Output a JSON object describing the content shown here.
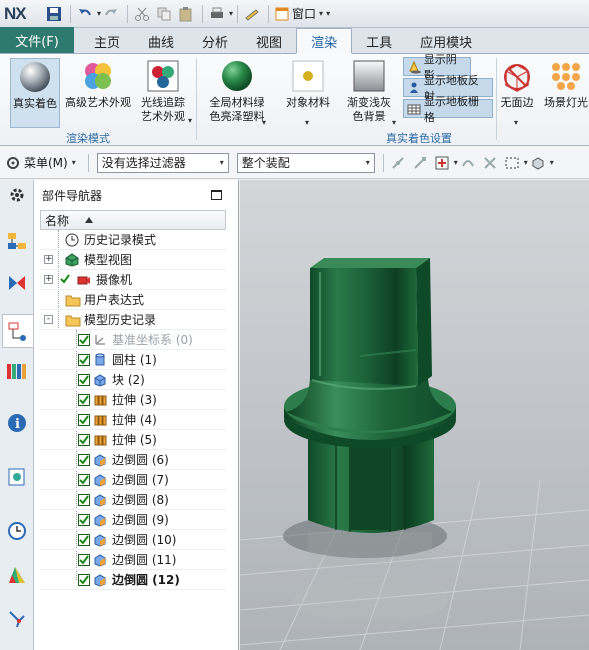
{
  "app": {
    "logo": "NX",
    "window_menu_label": "窗口"
  },
  "ribbon_tabs": [
    "文件(F)",
    "主页",
    "曲线",
    "分析",
    "视图",
    "渲染",
    "工具",
    "应用模块"
  ],
  "active_tab": "渲染",
  "ribbon": {
    "render_mode_group": {
      "label": "渲染模式",
      "items": [
        {
          "label": "真实着色",
          "selected": true
        },
        {
          "label": "高级艺术外观"
        },
        {
          "label": "光线追踪\n艺术外观"
        }
      ]
    },
    "realistic_shading_group": {
      "label": "真实着色设置",
      "items": [
        {
          "label": "全局材料绿\n色亮泽塑料"
        },
        {
          "label": "对象材料"
        },
        {
          "label": "渐变浅灰\n色背景"
        }
      ],
      "toggles": [
        {
          "label": "显示阴影",
          "on": true
        },
        {
          "label": "显示地板反射",
          "on": true
        },
        {
          "label": "显示地板栅格",
          "on": true
        }
      ]
    },
    "extra_items": [
      {
        "label": "无面边"
      },
      {
        "label": "场景灯光"
      }
    ]
  },
  "toolbar2": {
    "menu_label": "菜单(M)",
    "filter_value": "没有选择过滤器",
    "scope_value": "整个装配"
  },
  "navigator": {
    "title": "部件导航器",
    "column_header": "名称",
    "items": [
      {
        "label": "历史记录模式",
        "icon": "clock-icon",
        "level": 0
      },
      {
        "label": "模型视图",
        "icon": "model-view-icon",
        "level": 0,
        "expandable": "+"
      },
      {
        "label": "摄像机",
        "icon": "camera-icon",
        "level": 0,
        "expandable": "+",
        "check": "green"
      },
      {
        "label": "用户表达式",
        "icon": "folder-icon",
        "level": 0
      },
      {
        "label": "模型历史记录",
        "icon": "folder-icon",
        "level": 0,
        "expandable": "-"
      },
      {
        "label": "基准坐标系 (0)",
        "icon": "datum-csys-icon",
        "level": 1,
        "dim": true
      },
      {
        "label": "圆柱 (1)",
        "icon": "cylinder-icon",
        "level": 1
      },
      {
        "label": "块 (2)",
        "icon": "block-icon",
        "level": 1
      },
      {
        "label": "拉伸 (3)",
        "icon": "extrude-icon",
        "level": 1
      },
      {
        "label": "拉伸 (4)",
        "icon": "extrude-icon",
        "level": 1
      },
      {
        "label": "拉伸 (5)",
        "icon": "extrude-icon",
        "level": 1
      },
      {
        "label": "边倒圆 (6)",
        "icon": "edge-blend-icon",
        "level": 1
      },
      {
        "label": "边倒圆 (7)",
        "icon": "edge-blend-icon",
        "level": 1
      },
      {
        "label": "边倒圆 (8)",
        "icon": "edge-blend-icon",
        "level": 1
      },
      {
        "label": "边倒圆 (9)",
        "icon": "edge-blend-icon",
        "level": 1
      },
      {
        "label": "边倒圆 (10)",
        "icon": "edge-blend-icon",
        "level": 1
      },
      {
        "label": "边倒圆 (11)",
        "icon": "edge-blend-icon",
        "level": 1
      },
      {
        "label": "边倒圆 (12)",
        "icon": "edge-blend-icon",
        "level": 1,
        "bold": true
      }
    ]
  },
  "resource_bar_icons": [
    "gear-icon",
    "assembly-navigator-icon",
    "constraint-navigator-icon",
    "part-navigator-icon",
    "reuse-library-icon",
    "help-icon",
    "web-browser-icon",
    "history-icon",
    "system-materials-icon",
    "process-studio-icon"
  ],
  "colors": {
    "accent": "#2f7a6e",
    "active_tab_text": "#1d5fa8",
    "model_green": "#1f6b3b",
    "group_label": "#2d6aa5"
  }
}
